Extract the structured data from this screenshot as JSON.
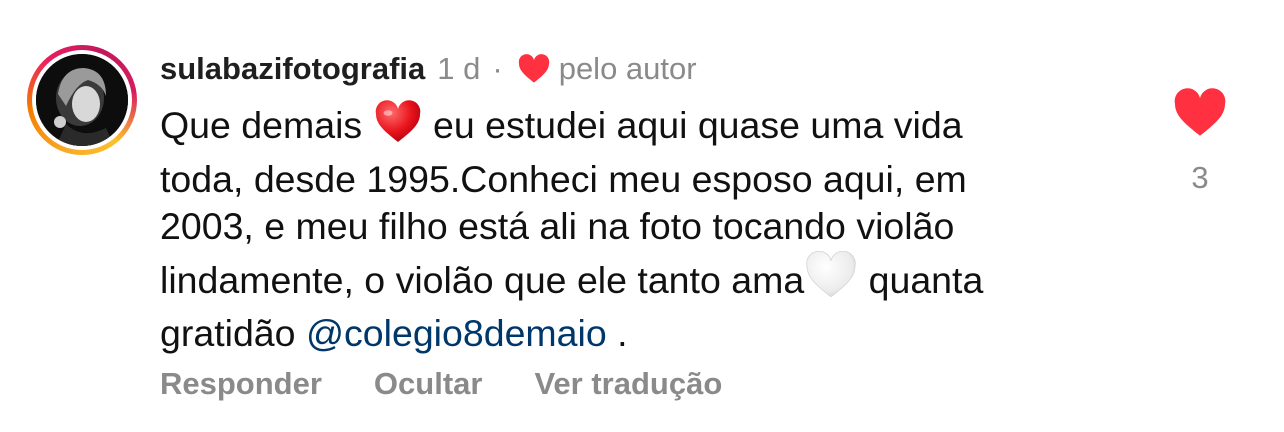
{
  "comment": {
    "username": "sulabazifotografia",
    "time_ago": "1 d",
    "separator": "·",
    "liked_by_author_label": "pelo autor",
    "body": {
      "line1_part1": "Que demais",
      "line1_part2": "eu estudei aqui quase uma vida",
      "line2": "toda, desde 1995.Conheci meu esposo aqui, em",
      "line3": "2003, e meu filho está ali na foto tocando violão",
      "line4_part1": "lindamente, o violão que ele tanto ama",
      "line4_part2": "quanta",
      "line5_part1": "gratidão",
      "mention": "@colegio8demaio",
      "line5_part2": "."
    },
    "actions": {
      "reply": "Responder",
      "hide": "Ocultar",
      "translate": "Ver tradução"
    },
    "like_count": "3",
    "icons": {
      "author_heart": "heart-icon",
      "body_heart": "red-heart-emoji",
      "body_white_heart": "white-heart-emoji",
      "like": "heart-icon"
    },
    "colors": {
      "heart_red": "#ff3040",
      "mention_blue": "#00376b",
      "muted_gray": "#8a8a8a"
    }
  }
}
